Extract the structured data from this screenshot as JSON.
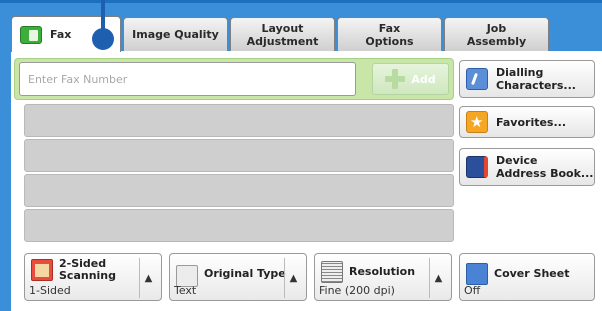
{
  "tabs": {
    "fax": "Fax",
    "image_quality": "Image Quality",
    "layout_adjustment": "Layout\nAdjustment",
    "fax_options": "Fax\nOptions",
    "job_assembly": "Job\nAssembly"
  },
  "fax_entry": {
    "placeholder": "Enter Fax Number",
    "add_label": "Add"
  },
  "side_buttons": {
    "dialling": "Dialling\nCharacters...",
    "favorites": "Favorites...",
    "address_book": "Device\nAddress Book..."
  },
  "features": {
    "two_sided": {
      "title": "2-Sided\nScanning",
      "value": "1-Sided"
    },
    "original_type": {
      "title": "Original Type",
      "value": "Text"
    },
    "resolution": {
      "title": "Resolution",
      "value": "Fine (200 dpi)"
    },
    "cover_sheet": {
      "title": "Cover Sheet",
      "value": "Off"
    }
  },
  "colors": {
    "frame": "#3a8fd8",
    "fax_accent": "#3cae3a",
    "input_area": "#c8e6a8"
  }
}
